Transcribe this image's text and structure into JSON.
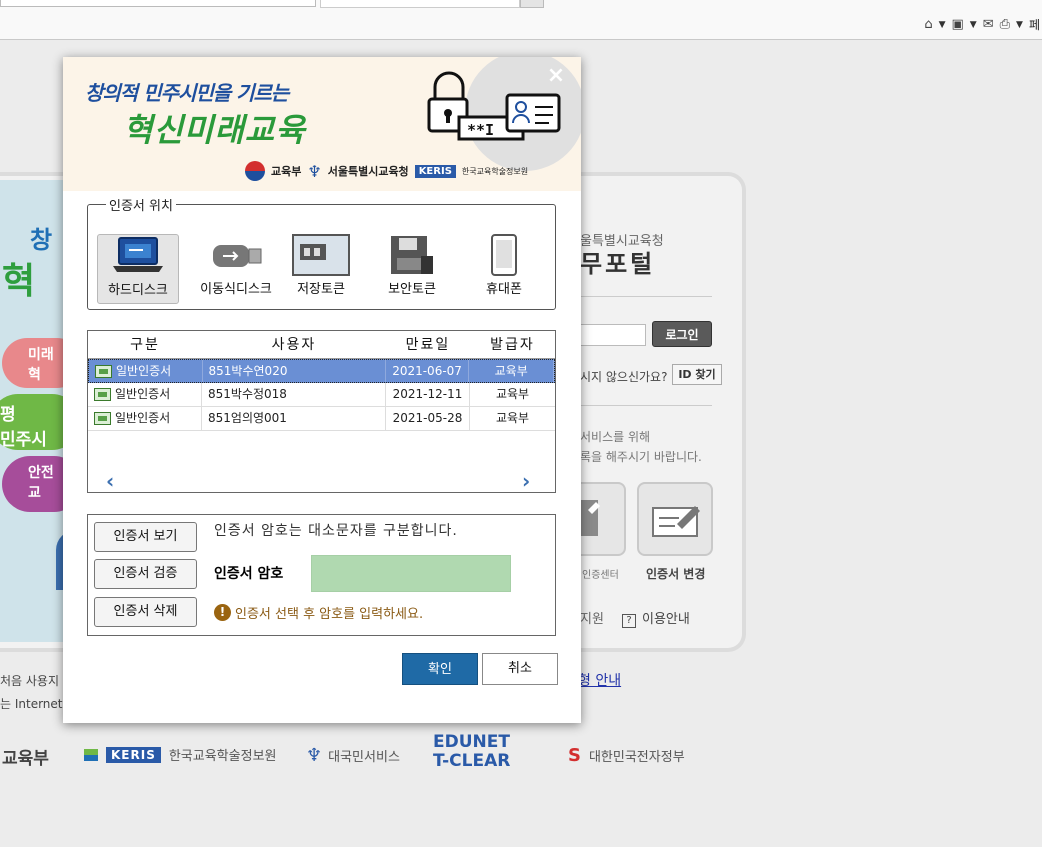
{
  "browser": {
    "command_bar": {
      "page_label": "페"
    }
  },
  "background": {
    "banner_left": {
      "title1": "창",
      "title2": "혁",
      "pill1": "미래\n혁",
      "pill2": "평\n민주시",
      "pill3": "안전\n교"
    },
    "portal_sub": "울특별시교육청",
    "portal_title": "무포털",
    "login_button": "로그인",
    "forgot_text": "시지 않으신가요?",
    "id_find_button": "ID 찾기",
    "service_line1": "서비스를 위해",
    "service_line2": "록을 해주시기 바랍니다.",
    "icon_label1": "인증센터",
    "icon_label2": "인증서 변경",
    "support": "지원",
    "help": "이용안내",
    "guide_link": "형 안내",
    "left_text1": "처음 사용지",
    "left_text2": "는 Internet"
  },
  "footer": {
    "moe": "교육부",
    "keris_badge": "KERIS",
    "keris_name": "한국교육학술정보원",
    "minwon": "대국민서비스",
    "edunet": "EDUNET",
    "tclear": "T-CLEAR",
    "egov": "대한민국전자정부"
  },
  "modal": {
    "header": {
      "slogan_line1": "창의적 민주시민을 기르는",
      "slogan_line2": "혁신미래교육",
      "org1": "교육부",
      "org2": "서울특별시교육청",
      "org3_badge": "KERIS",
      "org3_name": "한국교육학술정보원"
    },
    "location": {
      "legend": "인증서 위치",
      "devices": [
        {
          "label": "하드디스크",
          "icon": "laptop-icon",
          "selected": true
        },
        {
          "label": "이동식디스크",
          "icon": "usb-drive-icon",
          "selected": false
        },
        {
          "label": "저장토큰",
          "icon": "storage-token-icon",
          "selected": false
        },
        {
          "label": "보안토큰",
          "icon": "security-token-icon",
          "selected": false
        },
        {
          "label": "휴대폰",
          "icon": "mobile-phone-icon",
          "selected": false
        }
      ]
    },
    "table": {
      "headers": [
        "구분",
        "사용자",
        "만료일",
        "발급자"
      ],
      "rows": [
        {
          "type": "일반인증서",
          "user": "851박수연020",
          "expires": "2021-06-07",
          "issuer": "교육부",
          "selected": true
        },
        {
          "type": "일반인증서",
          "user": "851박수정018",
          "expires": "2021-12-11",
          "issuer": "교육부",
          "selected": false
        },
        {
          "type": "일반인증서",
          "user": "851엄의영001",
          "expires": "2021-05-28",
          "issuer": "교육부",
          "selected": false
        }
      ],
      "scroll_left": "‹",
      "scroll_right": "›"
    },
    "password": {
      "view_button": "인증서 보기",
      "verify_button": "인증서 검증",
      "delete_button": "인증서 삭제",
      "case_info": "인증서 암호는 대소문자를 구분합니다.",
      "label": "인증서 암호",
      "value": "",
      "warning": "인증서 선택 후 암호를 입력하세요.",
      "warning_icon": "!"
    },
    "ok_button": "확인",
    "cancel_button": "취소",
    "close_icon": "×"
  },
  "colors": {
    "ok_blue": "#1f6aa6",
    "selected_row": "#6a8fd4",
    "password_field": "#b0d9b0",
    "slogan_green": "#2a9a3a",
    "slogan_blue": "#1e4f9e"
  }
}
